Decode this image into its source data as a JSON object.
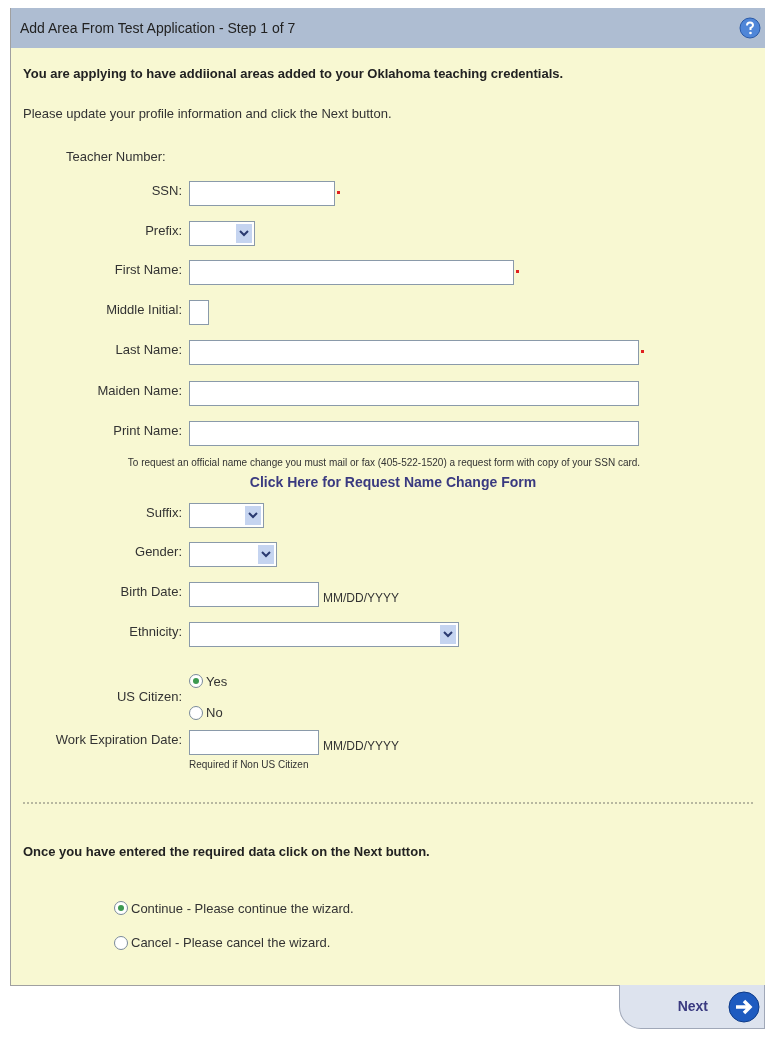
{
  "window": {
    "title": "Add Area From Test Application - Step 1 of 7"
  },
  "intro": "You are applying to have addiional areas added to your Oklahoma teaching credentials.",
  "instructions": "Please update your profile information and click the Next button.",
  "fields": [
    {
      "kind": "static",
      "label": "Teacher Number:"
    },
    {
      "kind": "text",
      "label": "SSN:",
      "required": true
    },
    {
      "kind": "select",
      "label": "Prefix:"
    },
    {
      "kind": "text",
      "label": "First Name:",
      "required": true
    },
    {
      "kind": "text",
      "label": "Middle Initial:",
      "required": false
    },
    {
      "kind": "text",
      "label": "Last Name:",
      "required": true
    },
    {
      "kind": "text",
      "label": "Maiden Name:",
      "required": false
    },
    {
      "kind": "text",
      "label": "Print Name:",
      "required": false
    }
  ],
  "name_change_note": "To request an official name change you must mail or fax (405-522-1520) a request form with copy of your SSN card.",
  "name_change_link": "Click Here for Request Name Change Form",
  "fields_2": [
    {
      "kind": "select",
      "label": "Suffix:"
    },
    {
      "kind": "select",
      "label": "Gender:"
    },
    {
      "kind": "date",
      "label": "Birth Date:",
      "format": "MM/DD/YYYY"
    },
    {
      "kind": "select",
      "label": "Ethnicity:"
    },
    {
      "kind": "radio",
      "label": "US Citizen:",
      "options": [
        {
          "label": "Yes",
          "selected": true
        },
        {
          "label": "No",
          "selected": false
        }
      ]
    },
    {
      "kind": "date",
      "label": "Work Expiration Date:",
      "format": "MM/DD/YYYY",
      "hint": "Required if Non US Citizen"
    }
  ],
  "footer_text": "Once you have entered the required data click on the Next button.",
  "actions": [
    {
      "label": "Continue - Please continue the wizard.",
      "selected": true
    },
    {
      "label": "Cancel - Please cancel the wizard.",
      "selected": false
    }
  ],
  "next_button": "Next"
}
